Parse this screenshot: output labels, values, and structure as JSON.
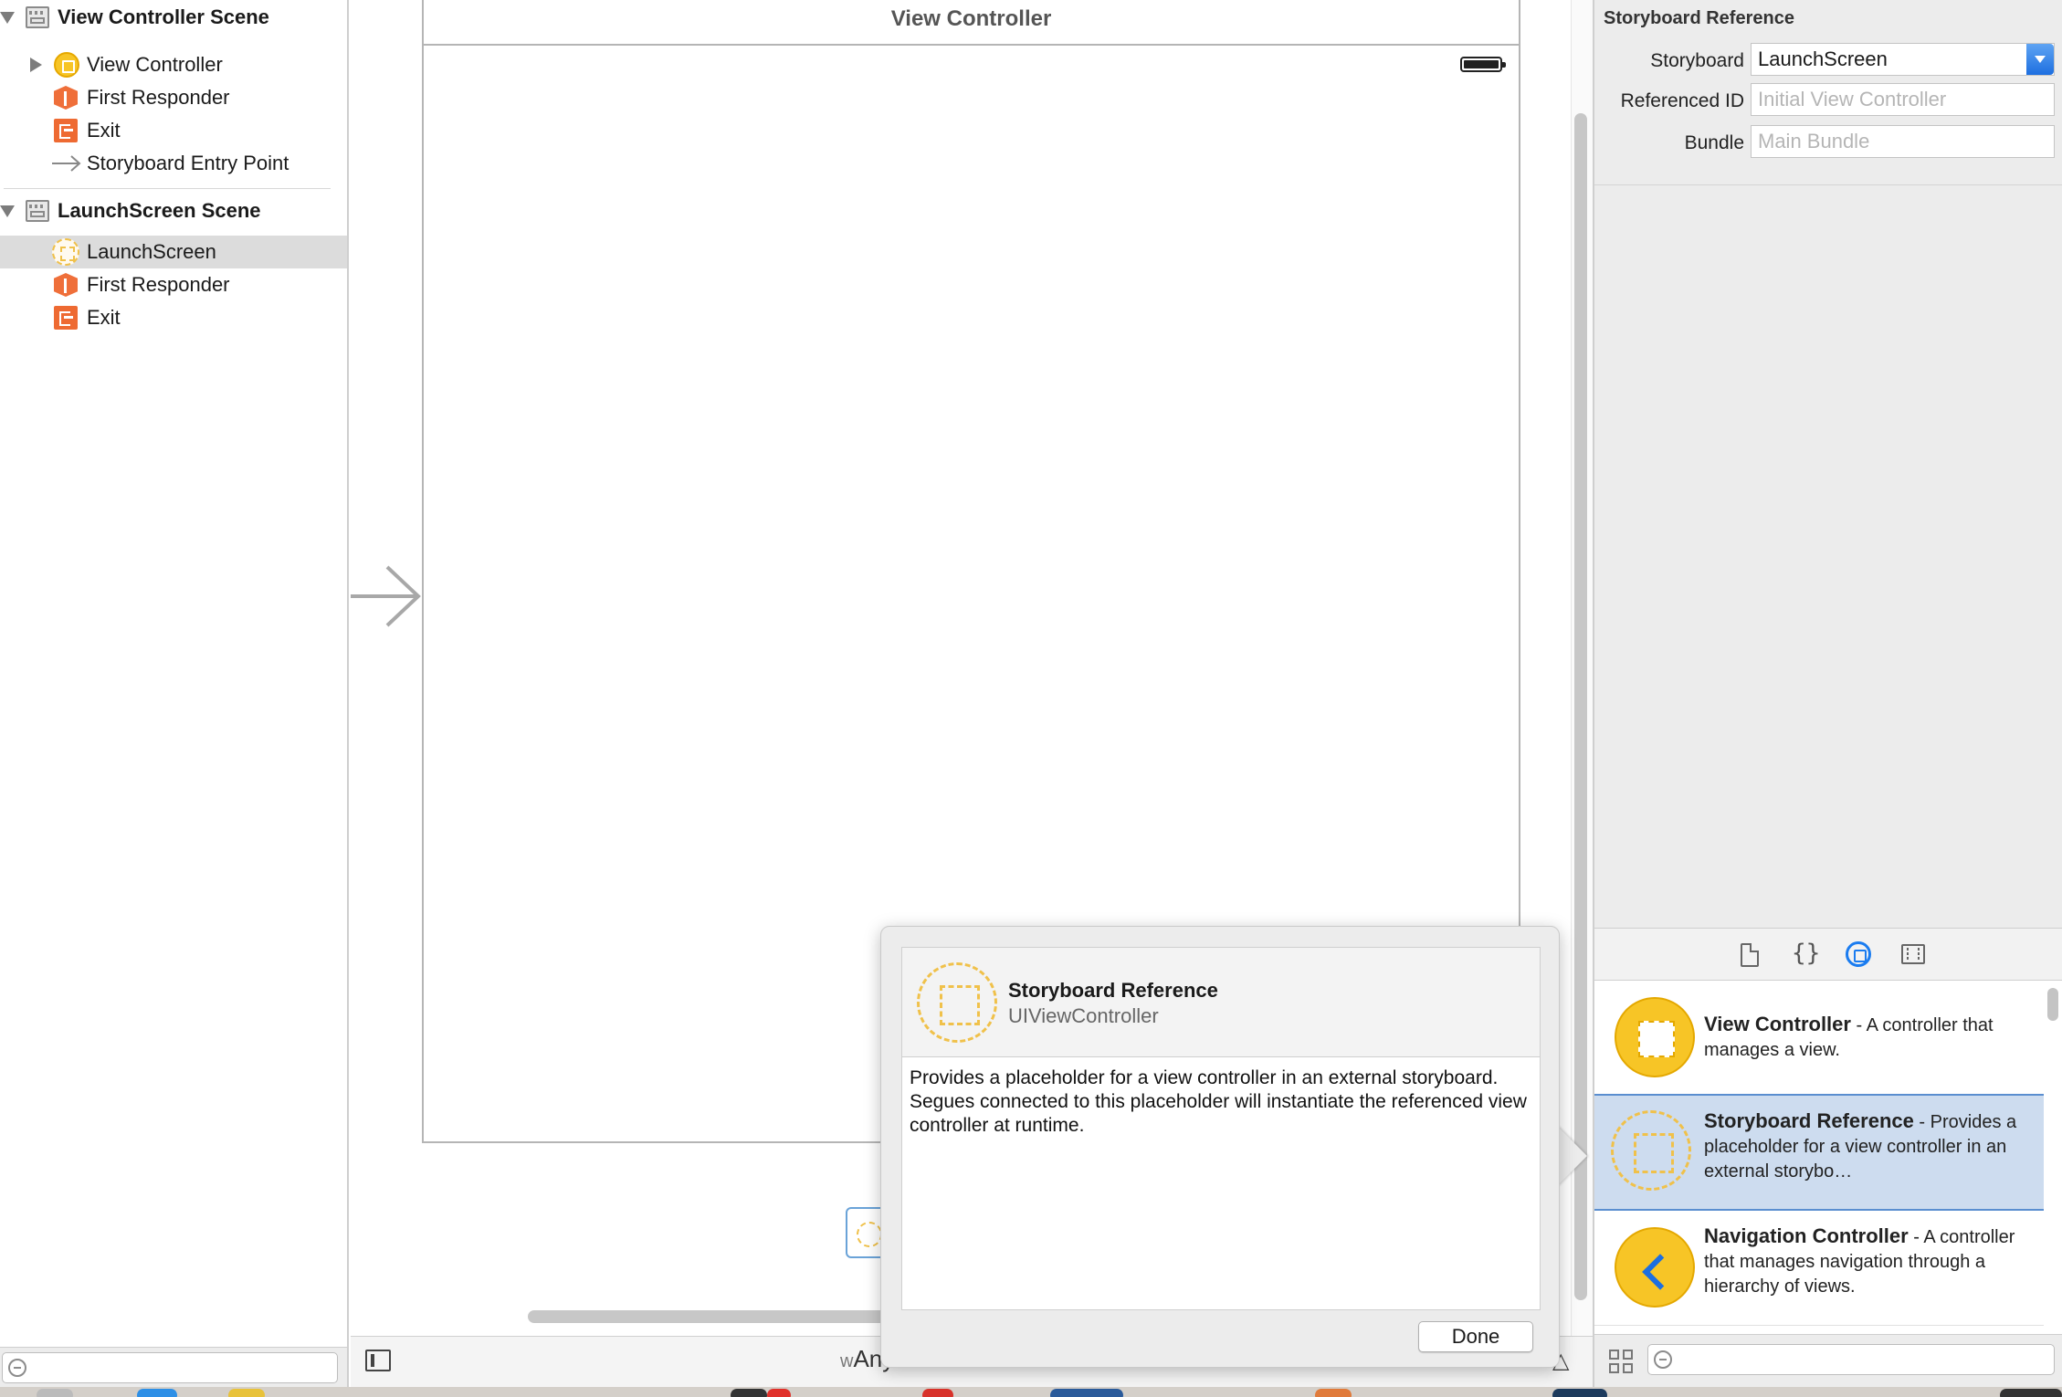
{
  "outline": {
    "scenes": [
      {
        "title": "View Controller Scene",
        "items": [
          "View Controller",
          "First Responder",
          "Exit",
          "Storyboard Entry Point"
        ]
      },
      {
        "title": "LaunchScreen Scene",
        "items": [
          "LaunchScreen",
          "First Responder",
          "Exit"
        ]
      }
    ],
    "selected_item": "LaunchScreen"
  },
  "canvas": {
    "scene_title": "View Controller",
    "size_class": {
      "w_prefix": "w",
      "value": "Any"
    }
  },
  "inspector": {
    "section_title": "Storyboard Reference",
    "fields": [
      {
        "label": "Storyboard",
        "value": "LaunchScreen",
        "placeholder": ""
      },
      {
        "label": "Referenced ID",
        "value": "",
        "placeholder": "Initial View Controller"
      },
      {
        "label": "Bundle",
        "value": "",
        "placeholder": "Main Bundle"
      }
    ],
    "library_tabs": [
      "file-template-icon",
      "code-snippet-icon",
      "object-library-icon",
      "media-library-icon"
    ],
    "active_tab": "object-library-icon"
  },
  "library": {
    "items": [
      {
        "name": "View Controller",
        "desc": " - A controller that manages a view.",
        "icon": "view-controller-icon"
      },
      {
        "name": "Storyboard Reference",
        "desc": " - Provides a placeholder for a view controller in an external storybo…",
        "icon": "storyboard-reference-icon"
      },
      {
        "name": "Navigation Controller",
        "desc": " - A controller that manages navigation through a hierarchy of views.",
        "icon": "navigation-controller-icon"
      }
    ],
    "selected": "Storyboard Reference"
  },
  "popover": {
    "title": "Storyboard Reference",
    "subtitle": "UIViewController",
    "description": "Provides a placeholder for a view controller in an external storyboard. Segues connected to this placeholder will instantiate the referenced view controller at runtime.",
    "done_label": "Done"
  },
  "colors": {
    "accent": "#1d6fe0",
    "selection": "#cddcef",
    "vc_yellow": "#f7c526",
    "responder_orange": "#ef6f3a"
  }
}
